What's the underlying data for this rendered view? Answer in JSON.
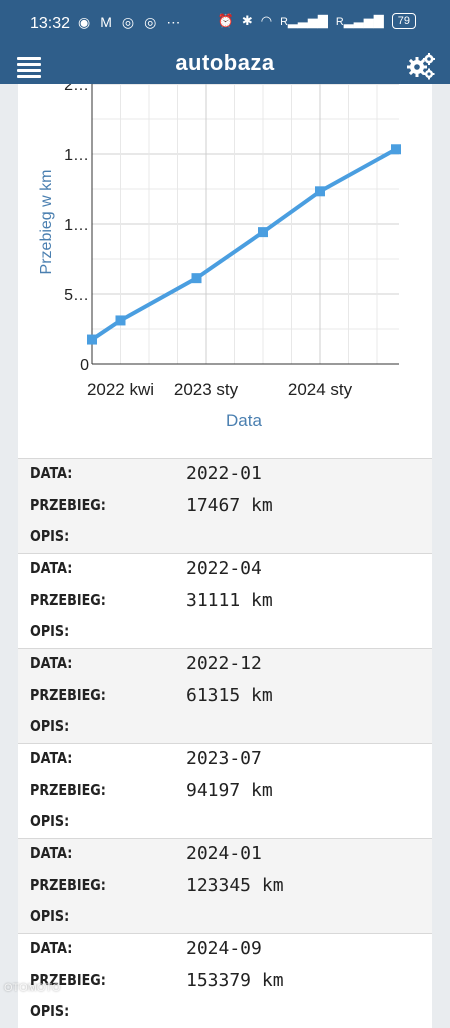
{
  "status_bar": {
    "time": "13:32",
    "battery": "79",
    "signal_labels": [
      "R",
      "R"
    ]
  },
  "app_bar": {
    "logo": "autobaza"
  },
  "chart_data": {
    "type": "line",
    "xlabel": "Data",
    "ylabel": "Przebieg w km",
    "x_tick_labels": [
      "2022 kwi",
      "2023 sty",
      "2024 sty"
    ],
    "y_tick_labels": [
      "0",
      "5…",
      "1…",
      "1…",
      "2…"
    ],
    "points": [
      {
        "date": "2022-01",
        "km": 17467
      },
      {
        "date": "2022-04",
        "km": 31111
      },
      {
        "date": "2022-12",
        "km": 61315
      },
      {
        "date": "2023-07",
        "km": 94197
      },
      {
        "date": "2024-01",
        "km": 123345
      },
      {
        "date": "2024-09",
        "km": 153379
      }
    ],
    "ylim": [
      0,
      200000
    ],
    "grid": true,
    "line_color": "#4a9ee0"
  },
  "labels": {
    "date": "DATA:",
    "mileage": "PRZEBIEG:",
    "description": "OPIS:"
  },
  "entries": [
    {
      "date": "2022-01",
      "mileage": "17467 km",
      "description": ""
    },
    {
      "date": "2022-04",
      "mileage": "31111 km",
      "description": ""
    },
    {
      "date": "2022-12",
      "mileage": "61315 km",
      "description": ""
    },
    {
      "date": "2023-07",
      "mileage": "94197 km",
      "description": ""
    },
    {
      "date": "2024-01",
      "mileage": "123345 km",
      "description": ""
    },
    {
      "date": "2024-09",
      "mileage": "153379 km",
      "description": ""
    }
  ]
}
